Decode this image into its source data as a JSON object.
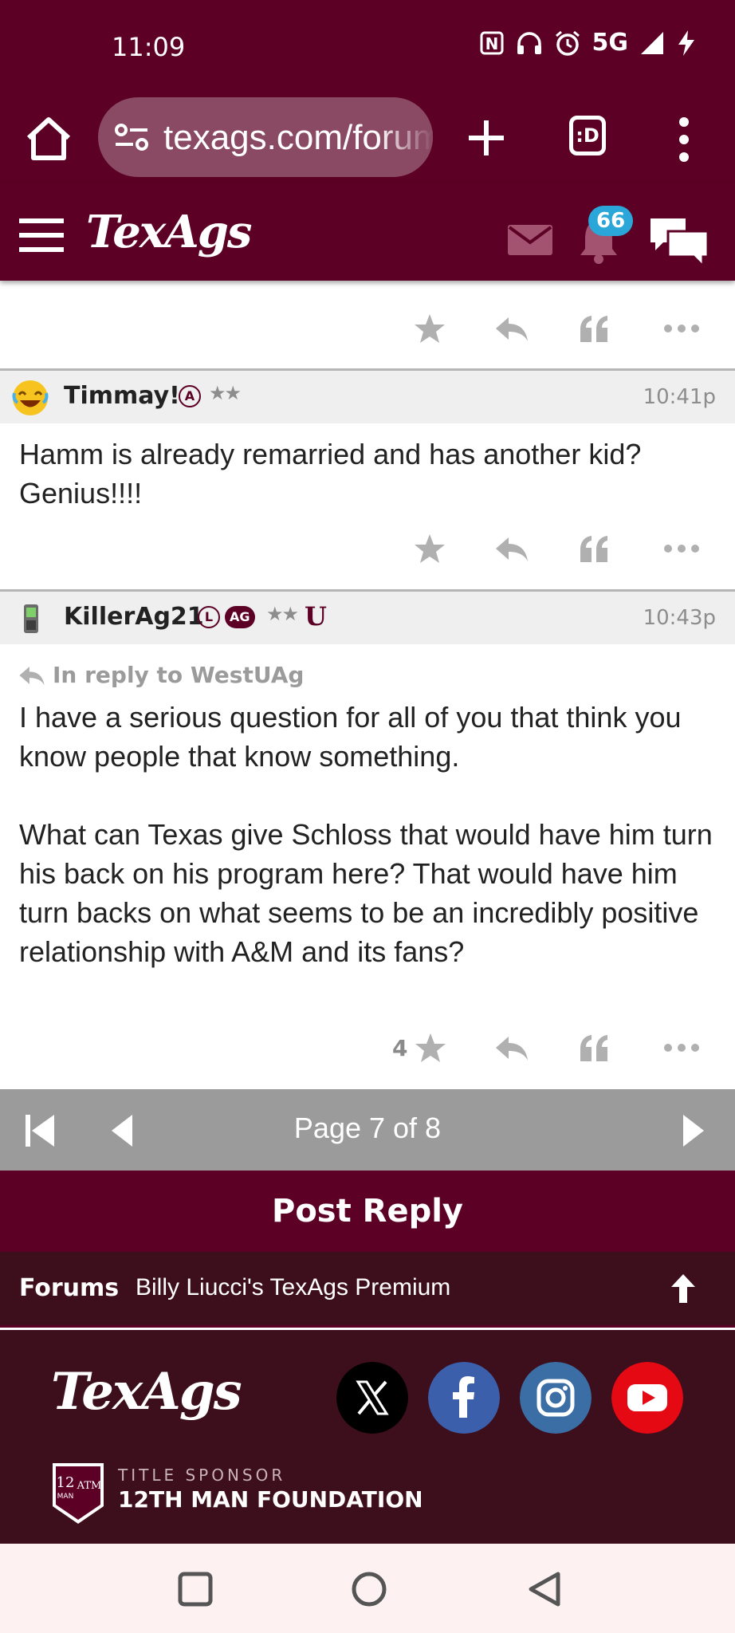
{
  "status_bar": {
    "time": "11:09",
    "network": "5G",
    "icons": [
      "nfc-icon",
      "headphones-icon",
      "alarm-icon",
      "signal-icon",
      "charging-icon"
    ]
  },
  "browser": {
    "url": "texags.com/forums",
    "tabs_label": ":D"
  },
  "site": {
    "logo": "TexAgs",
    "notification_count": "66",
    "accent_color": "#5c0025"
  },
  "posts": [
    {
      "actions": {
        "like_count": ""
      }
    },
    {
      "username": "Timmay!",
      "rank_badge": "A",
      "stars": "★★",
      "time": "10:41p",
      "body": "Hamm is already remarried and has another kid? Genius!!!!",
      "actions": {
        "like_count": ""
      }
    },
    {
      "username": "KillerAg21",
      "rank_badge": "L",
      "ag_badge": "AG",
      "stars": "★★",
      "u_badge": "U",
      "time": "10:43p",
      "reply_to": "In reply to WestUAg",
      "body_p1": "I have a serious question for all of you that think you know people that know something.",
      "body_p2": "What can Texas give Schloss that would have him turn his back on his program here? That would have him turn backs on what seems to be an incredibly positive relationship with A&M and its fans?",
      "actions": {
        "like_count": "4"
      }
    }
  ],
  "pagination": {
    "label": "Page 7 of 8",
    "current": 7,
    "total": 8
  },
  "post_reply_label": "Post Reply",
  "breadcrumb": {
    "forums": "Forums",
    "board": "Billy Liucci's TexAgs Premium"
  },
  "footer": {
    "logo": "TexAgs",
    "social": [
      "x-icon",
      "facebook-icon",
      "instagram-icon",
      "youtube-icon"
    ],
    "sponsor_label": "TITLE SPONSOR",
    "sponsor_name": "12TH MAN FOUNDATION"
  }
}
